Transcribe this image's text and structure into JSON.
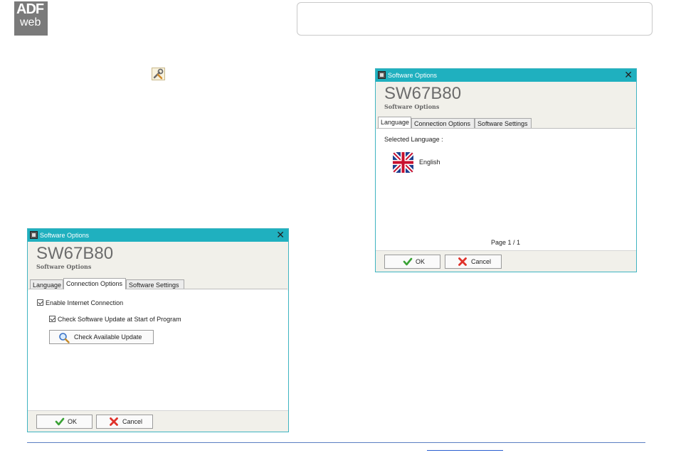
{
  "logo": {
    "line1": "ADF",
    "line2": "web"
  },
  "header_box": {
    "text": ""
  },
  "icons": {
    "tool": "wrench-settings-icon"
  },
  "dialog_left": {
    "window_title": "Software Options",
    "app_name": "SW67B80",
    "app_subtitle": "Software Options",
    "tabs": [
      {
        "label": "Language",
        "active": false
      },
      {
        "label": "Connection Options",
        "active": true
      },
      {
        "label": "Software Settings",
        "active": false
      }
    ],
    "enable_internet": {
      "label": "Enable Internet Connection",
      "checked": true
    },
    "check_update_start": {
      "label": "Check Software Update at Start of Program",
      "checked": true
    },
    "check_update_button": "Check Available Update",
    "ok_label": "OK",
    "cancel_label": "Cancel"
  },
  "dialog_right": {
    "window_title": "Software Options",
    "app_name": "SW67B80",
    "app_subtitle": "Software Options",
    "tabs": [
      {
        "label": "Language",
        "active": true
      },
      {
        "label": "Connection Options",
        "active": false
      },
      {
        "label": "Software Settings",
        "active": false
      }
    ],
    "selected_language_label": "Selected Language :",
    "language": "English",
    "page_indicator": "Page 1 / 1",
    "ok_label": "OK",
    "cancel_label": "Cancel"
  },
  "colors": {
    "titlebar": "#1fb0bf",
    "dialog_bg": "#f1f0ea",
    "footer_line": "#5b7fc2"
  }
}
